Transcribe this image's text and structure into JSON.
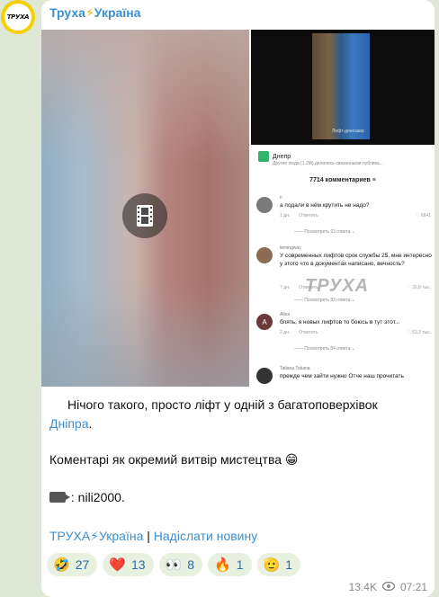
{
  "channel": {
    "name_prefix": "Труха",
    "name_suffix": "Україна",
    "avatar_text": "ТРУХА"
  },
  "video": {
    "icon": "film-icon"
  },
  "screenshot": {
    "photo_caption": "Лифт-динозавр",
    "header_title": "Днепр",
    "header_sub": "Другие люди (1,2М) делились связанными публика...",
    "comments_count": "7714 комментариев",
    "watermark": "ТРУХА",
    "comments": [
      {
        "user": "п",
        "text": "а подали в нём крутить не надо?",
        "date": "1 дн.",
        "reply": "Ответить",
        "likes": "6841",
        "more": "Посмотреть 23 ответа"
      },
      {
        "user": "lemingway",
        "text": "У современных лифтов срок службы 25, мне интересно у этого что в документах написано, вечность?",
        "date": "7 дн.",
        "reply": "Ответить",
        "likes": "26,8 тыс.",
        "more": "Посмотреть 83 ответа"
      },
      {
        "user": "Alina",
        "avatar_letter": "A",
        "text": "блять, я новых лифтов то боюсь в тут этот...",
        "date": "2 дн.",
        "reply": "Ответить",
        "likes": "53,3 тыс.",
        "more": "Посмотреть 84 ответа"
      },
      {
        "user": "Tatiana Tatiana",
        "text": "прежде чем зайти нужно Отче наш прочитать"
      }
    ]
  },
  "post": {
    "line1": "Нічого такого, просто ліфт у одній з багатоповерхівок",
    "link_city": "Дніпра",
    "line1_end": ".",
    "line2": "Коментарі як окремий витвір мистецтва 😁",
    "line3": ": nili2000."
  },
  "footer": {
    "channel_link": "ТРУХА⚡Україна",
    "separator": "|",
    "submit_link": "Надіслати новину"
  },
  "reactions": [
    {
      "emoji": "🤣",
      "count": "27"
    },
    {
      "emoji": "❤️",
      "count": "13"
    },
    {
      "emoji": "👀",
      "count": "8"
    },
    {
      "emoji": "🔥",
      "count": "1"
    },
    {
      "emoji": "🫡",
      "count": "1"
    }
  ],
  "meta": {
    "views": "13.4K",
    "time": "07:21"
  },
  "colors": {
    "link": "#3c8fd0",
    "background": "#dfe7d6",
    "reaction_bg": "#e8f1e0"
  }
}
